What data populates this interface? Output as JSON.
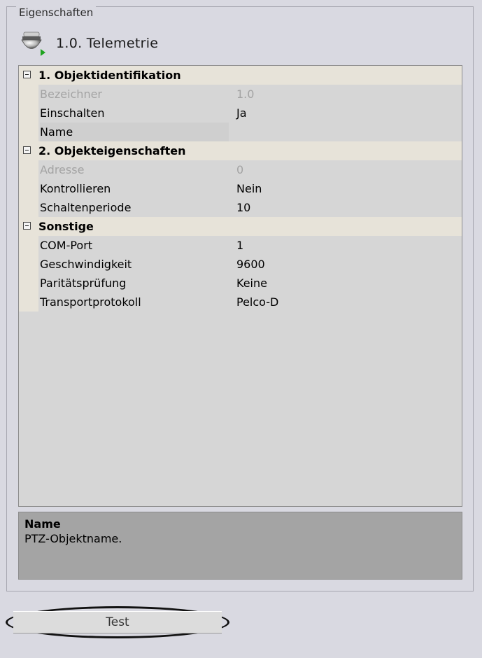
{
  "panel": {
    "group_title": "Eigenschaften",
    "object_title": "1.0. Telemetrie",
    "object_icon": "ptz-camera-icon"
  },
  "categories": [
    {
      "label": "1. Objektidentifikation",
      "properties": [
        {
          "name": "Bezeichner",
          "value": "1.0",
          "enabled": false
        },
        {
          "name": "Einschalten",
          "value": "Ja",
          "enabled": true
        },
        {
          "name": "Name",
          "value": "",
          "enabled": true,
          "selected": true
        }
      ]
    },
    {
      "label": "2. Objekteigenschaften",
      "properties": [
        {
          "name": "Adresse",
          "value": "0",
          "enabled": false
        },
        {
          "name": "Kontrollieren",
          "value": "Nein",
          "enabled": true
        },
        {
          "name": "Schaltenperiode",
          "value": "10",
          "enabled": true
        }
      ]
    },
    {
      "label": "Sonstige",
      "properties": [
        {
          "name": "COM-Port",
          "value": "1",
          "enabled": true
        },
        {
          "name": "Geschwindigkeit",
          "value": "9600",
          "enabled": true
        },
        {
          "name": "Paritätsprüfung",
          "value": "Keine",
          "enabled": true
        },
        {
          "name": "Transportprotokoll",
          "value": "Pelco-D",
          "enabled": true
        }
      ]
    }
  ],
  "description": {
    "title": "Name",
    "text": "PTZ-Objektname."
  },
  "buttons": {
    "test_label": "Test"
  }
}
